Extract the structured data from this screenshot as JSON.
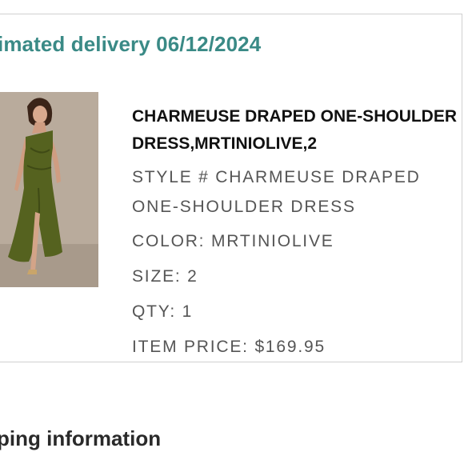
{
  "order": {
    "delivery_text": "imated delivery 06/12/2024"
  },
  "item": {
    "title": "CHARMEUSE DRAPED ONE-SHOULDER DRESS,MRTINIOLIVE,2",
    "style_line1": "STYLE # CHARMEUSE DRAPED",
    "style_line2": "ONE-SHOULDER DRESS",
    "color": "COLOR: MRTINIOLIVE",
    "size": "SIZE: 2",
    "qty": "QTY: 1",
    "price": "ITEM PRICE: $169.95",
    "image_background_color": "#b7a99a",
    "dress_color": "#55621f"
  },
  "shipping": {
    "heading": "ping information"
  }
}
